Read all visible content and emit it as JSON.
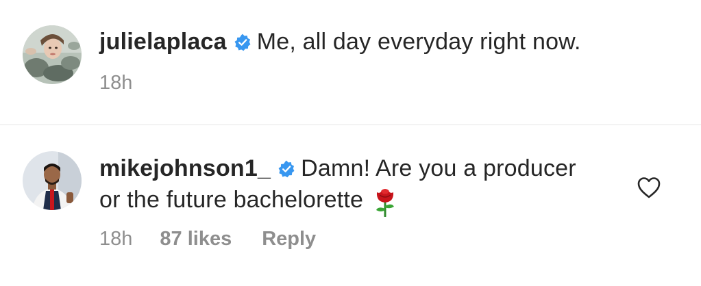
{
  "comments": [
    {
      "username": "julielaplaca",
      "verified": true,
      "text": "Me, all day everyday right now.",
      "time": "18h"
    },
    {
      "username": "mikejohnson1_",
      "verified": true,
      "text": "Damn! Are you a producer or the future bachelorette",
      "emoji": "rose-emoji",
      "time": "18h",
      "likes": "87 likes",
      "reply_label": "Reply"
    }
  ],
  "icons": {
    "verified_badge": "verified-badge-icon",
    "like": "heart-icon"
  },
  "colors": {
    "text": "#262626",
    "muted": "#8e8e8e",
    "verified_blue": "#3897f0",
    "divider": "#e6e6e6"
  }
}
